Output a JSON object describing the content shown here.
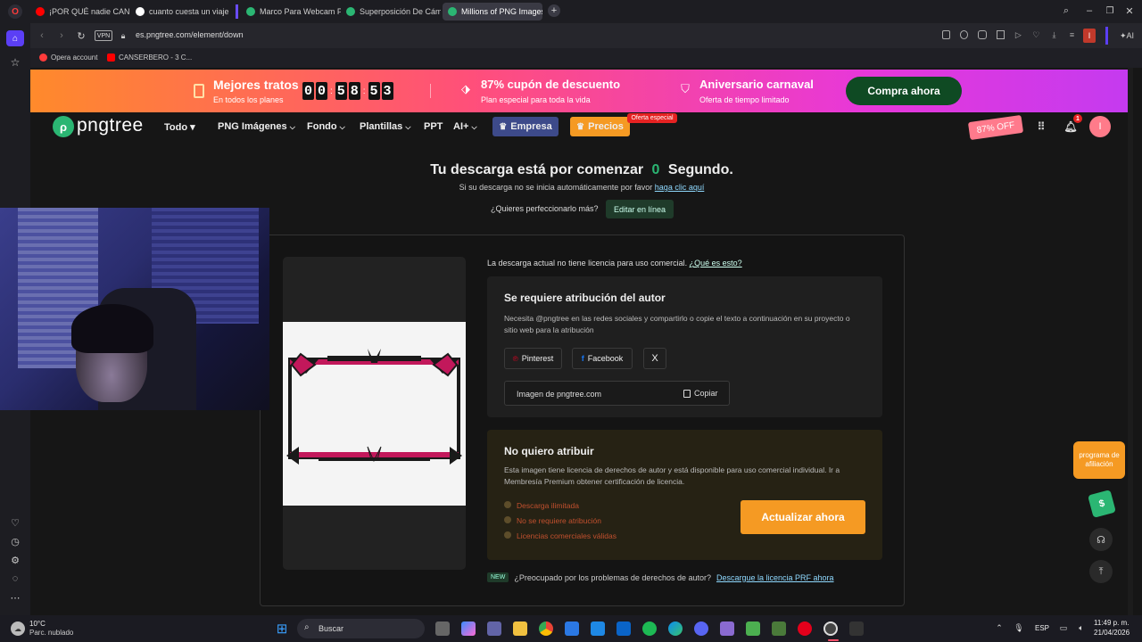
{
  "tabs": [
    {
      "label": "¡POR QUÉ nadie CANCELA",
      "active": false
    },
    {
      "label": "cuanto cuesta un viaje al e",
      "active": false
    },
    {
      "label": "Marco Para Webcam PNG",
      "active": false
    },
    {
      "label": "Superposición De Cámara",
      "active": false
    },
    {
      "label": "Millions of PNG Images, B",
      "active": true
    }
  ],
  "address": {
    "vpn": "VPN",
    "url": "es.pngtree.com/element/down"
  },
  "bookmarks": [
    "Opera account",
    "CANSERBERO - 3 C..."
  ],
  "promo": {
    "deals_title": "Mejores tratos",
    "deals_sub": "En todos los planes",
    "timer": [
      "0",
      "0",
      "5",
      "8",
      "5",
      "3"
    ],
    "coupon_title": "87% cupón de descuento",
    "coupon_sub": "Plan especial para toda la vida",
    "anniv_title": "Aniversario carnaval",
    "anniv_sub": "Oferta de tiempo limitado",
    "buy_button": "Compra ahora"
  },
  "nav": {
    "logo": "pngtree",
    "items": [
      "Todo ▾",
      "PNG Imágenes",
      "Fondo",
      "Plantillas",
      "PPT",
      "AI+"
    ],
    "empresa": "Empresa",
    "precios": "Precios",
    "oferta_badge": "Oferta especial",
    "discount": "87% OFF",
    "notif_count": "1",
    "avatar": "I"
  },
  "download": {
    "title_pre": "Tu descarga está por comenzar",
    "countdown": "0",
    "title_post": "Segundo.",
    "sub_text": "Si su descarga no se inicia automáticamente por favor",
    "sub_link": "haga clic aquí",
    "improve_q": "¿Quieres perfeccionarlo más?",
    "edit_button": "Editar en línea"
  },
  "license": {
    "notice": "La descarga actual no tiene licencia para uso comercial.",
    "notice_link": "¿Qué es esto?",
    "attr_title": "Se requiere atribución del autor",
    "attr_desc": "Necesita @pngtree en las redes sociales y compartirlo o copie el texto a continuación en su proyecto o sitio web para la atribución",
    "social": [
      "Pinterest",
      "Facebook",
      "X"
    ],
    "attr_text": "Imagen de pngtree.com",
    "copy": "Copiar",
    "no_attr_title": "No quiero atribuir",
    "no_attr_desc": "Esta imagen tiene licencia de derechos de autor y está disponible para uso comercial individual. Ir a Membresía Premium obtener certificación de licencia.",
    "features": [
      "Descarga ilimitada",
      "No se requiere atribución",
      "Licencias comerciales válidas"
    ],
    "upgrade": "Actualizar ahora",
    "new_tag": "NEW",
    "copyright_q": "¿Preocupado por los problemas de derechos de autor?",
    "copyright_link": "Descargue la licencia PRF ahora"
  },
  "affiliate": "programa de afiliación",
  "taskbar": {
    "weather_temp": "10°C",
    "weather_desc": "Parc. nublado",
    "search": "Buscar",
    "lang": "ESP",
    "time": "11:49 p. m.",
    "date": "21/04/2026"
  },
  "colors": {
    "accent_green": "#0f4a23",
    "orange": "#f59a23",
    "pink": "#ff4f7a"
  }
}
